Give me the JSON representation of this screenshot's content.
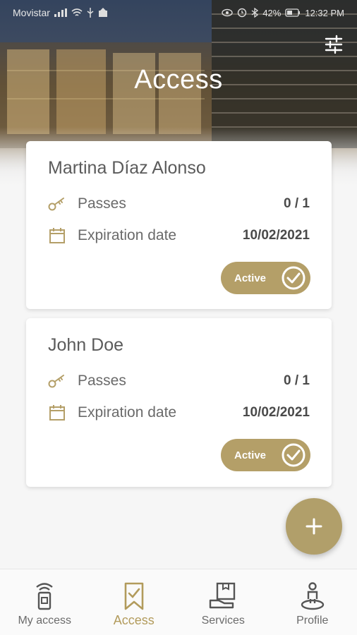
{
  "status_bar": {
    "carrier": "Movistar",
    "battery": "42%",
    "time": "12:32 PM"
  },
  "header": {
    "title": "Access",
    "filter_icon": "sliders-icon"
  },
  "cards": [
    {
      "name": "Martina Díaz Alonso",
      "passes_label": "Passes",
      "passes_value": "0 / 1",
      "expiration_label": "Expiration date",
      "expiration_value": "10/02/2021",
      "status_label": "Active"
    },
    {
      "name": "John Doe",
      "passes_label": "Passes",
      "passes_value": "0 / 1",
      "expiration_label": "Expiration date",
      "expiration_value": "10/02/2021",
      "status_label": "Active"
    }
  ],
  "fab": {
    "icon": "plus-icon"
  },
  "bottom_nav": {
    "items": [
      {
        "label": "My access",
        "icon": "access-card-icon"
      },
      {
        "label": "Access",
        "icon": "bookmark-check-icon"
      },
      {
        "label": "Services",
        "icon": "services-box-icon"
      },
      {
        "label": "Profile",
        "icon": "person-pin-icon"
      }
    ],
    "active_index": 1
  },
  "colors": {
    "accent": "#b49f68",
    "accent_text": "#b29b5c",
    "background": "#f6f6f6"
  }
}
